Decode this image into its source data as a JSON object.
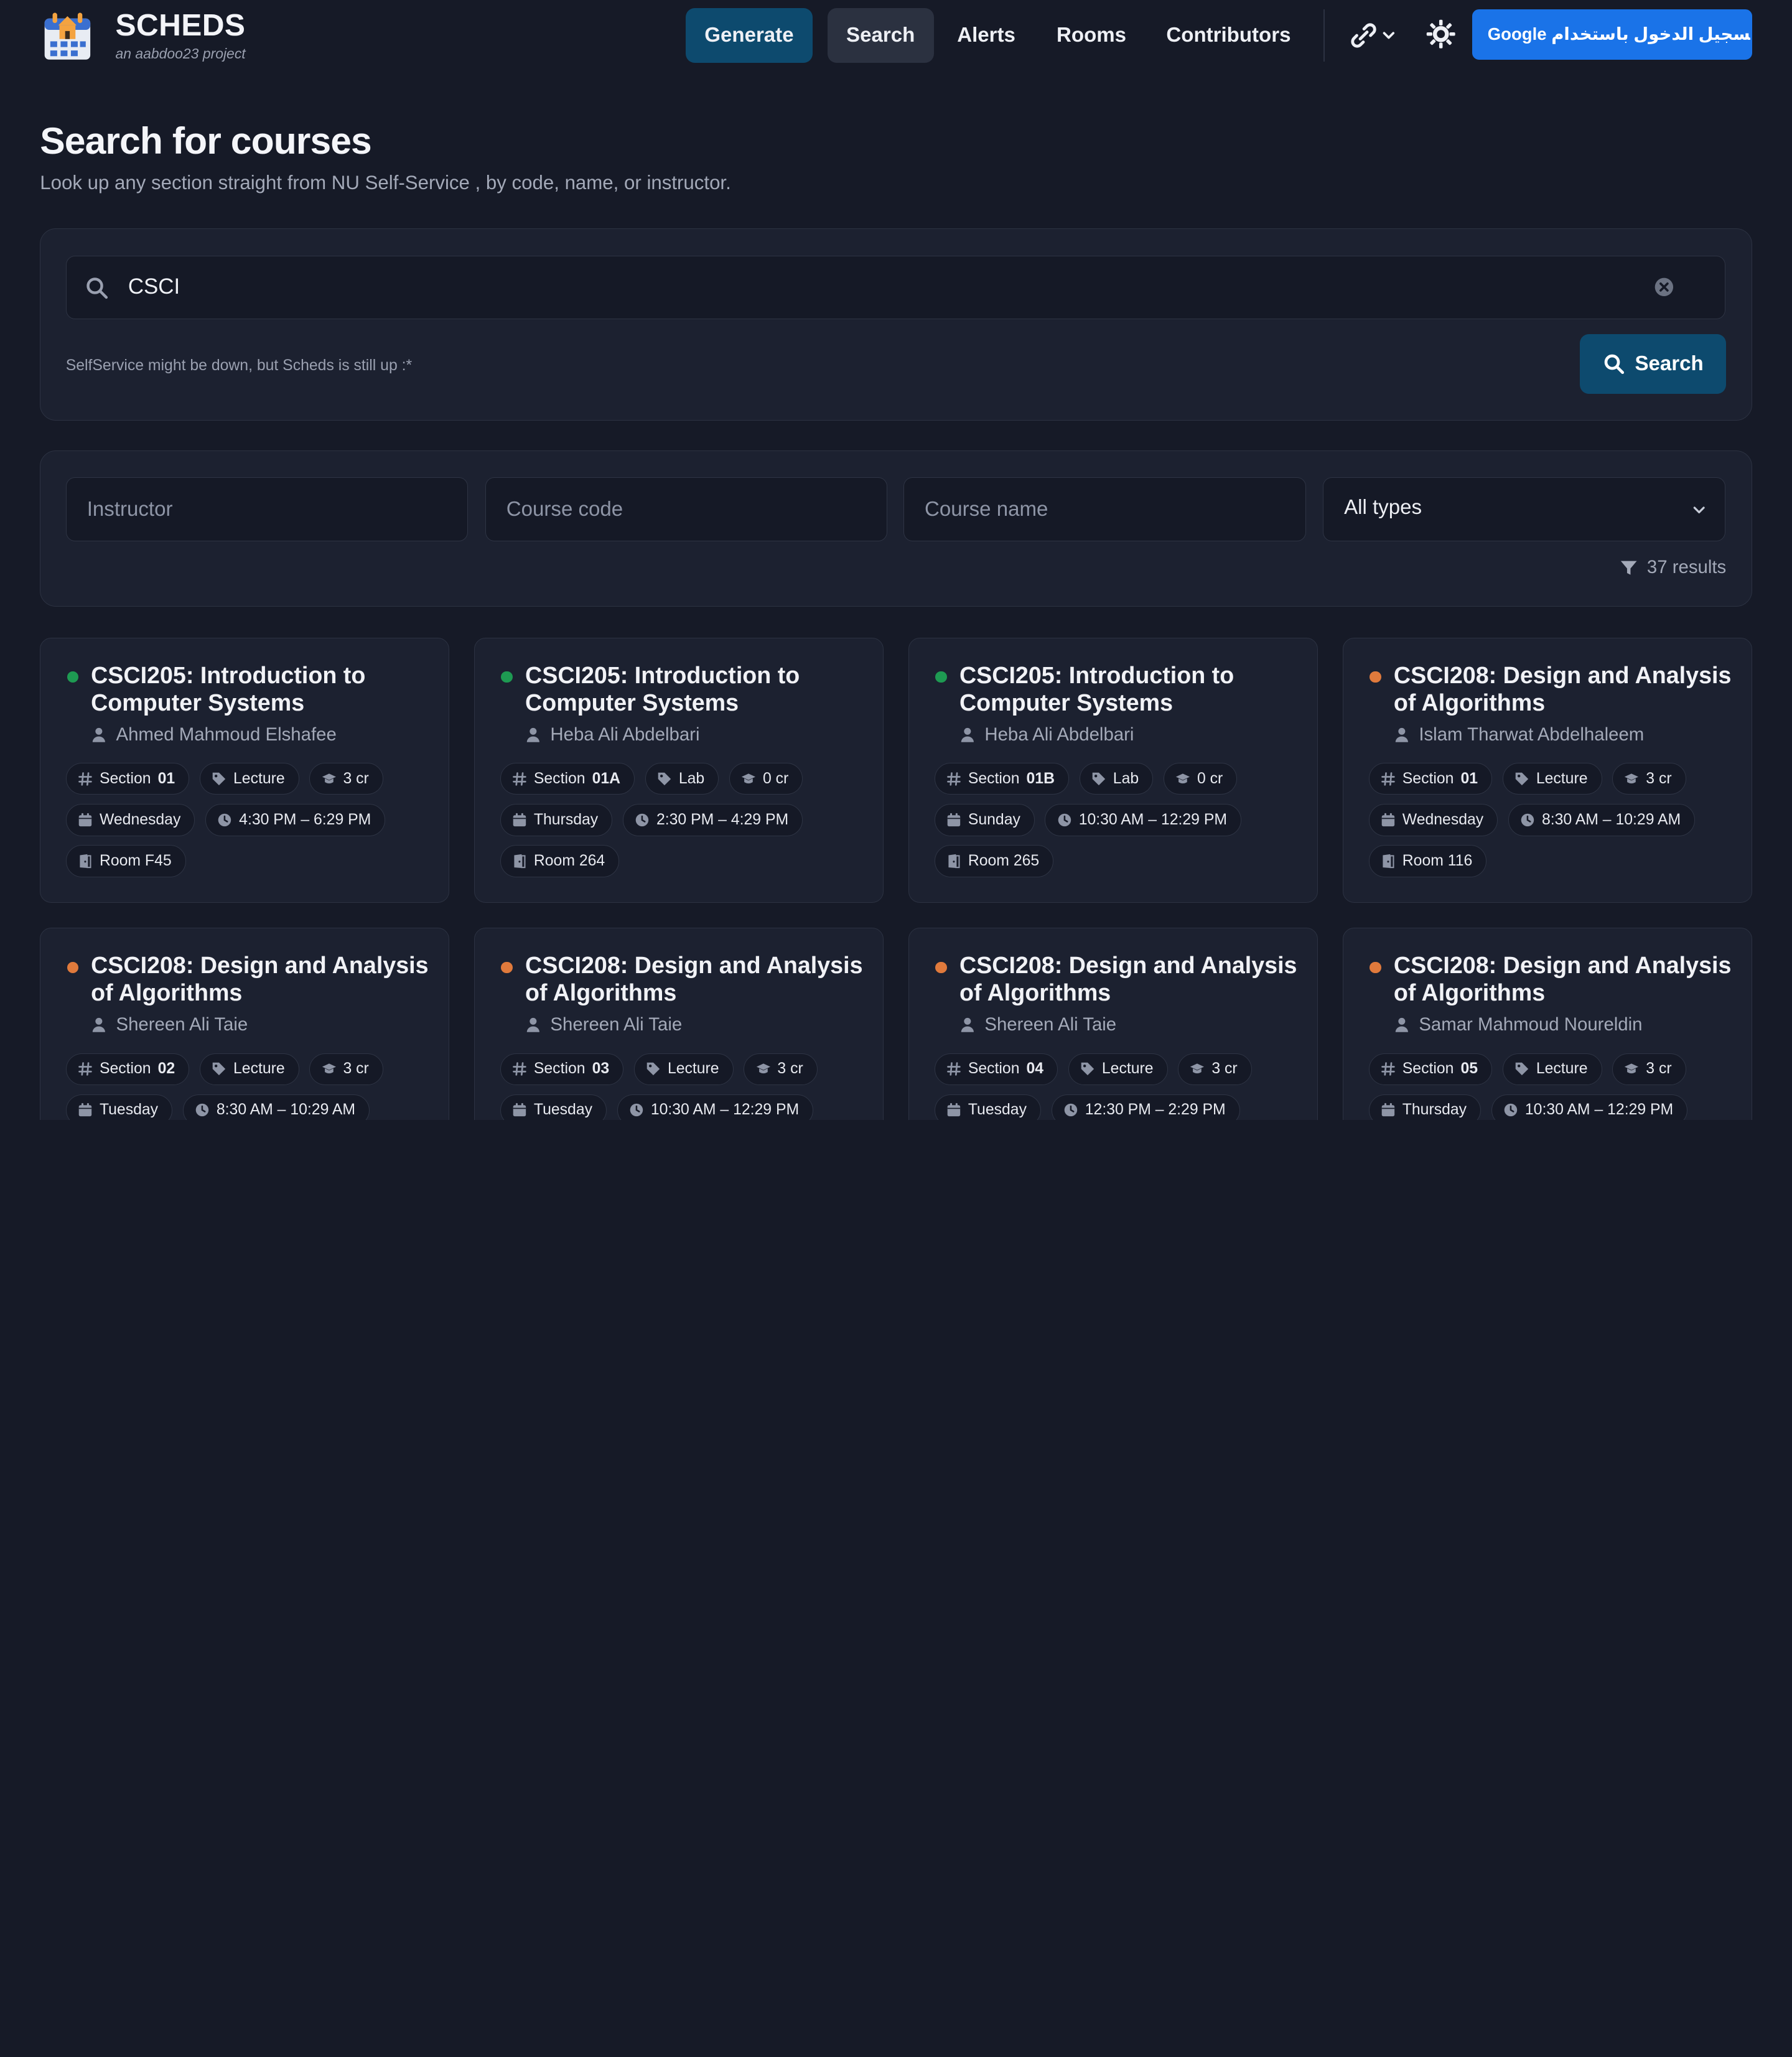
{
  "brand": {
    "title": "SCHEDS",
    "subtitle": "an aabdoo23 project"
  },
  "nav": {
    "generate": "Generate",
    "search": "Search",
    "alerts": "Alerts",
    "rooms": "Rooms",
    "contributors": "Contributors",
    "google_signin": "تسجيل الدخول باستخدام Google"
  },
  "page": {
    "title": "Search for courses",
    "subtitle": "Look up any section straight from NU Self-Service , by code, name, or instructor."
  },
  "search": {
    "query": "CSCI",
    "hint": "SelfService might be down, but Scheds is still up :*",
    "button": "Search"
  },
  "filters": {
    "instructor_placeholder": "Instructor",
    "code_placeholder": "Course code",
    "name_placeholder": "Course name",
    "type_selected": "All types",
    "results": "37 results"
  },
  "colors": {
    "green": "#1e9a52",
    "orange": "#e07a3c",
    "accent": "#0d4a6e"
  },
  "section_label": "Section",
  "cards": [
    {
      "status": "green",
      "title": "CSCI205: Introduction to Computer Systems",
      "instructor": "Ahmed Mahmoud Elshafee",
      "section": "01",
      "type": "Lecture",
      "credits": "3 cr",
      "day": "Wednesday",
      "time": "4:30 PM – 6:29 PM",
      "room": "Room F45"
    },
    {
      "status": "green",
      "title": "CSCI205: Introduction to Computer Systems",
      "instructor": "Heba Ali Abdelbari",
      "section": "01A",
      "type": "Lab",
      "credits": "0 cr",
      "day": "Thursday",
      "time": "2:30 PM – 4:29 PM",
      "room": "Room 264"
    },
    {
      "status": "green",
      "title": "CSCI205: Introduction to Computer Systems",
      "instructor": "Heba Ali Abdelbari",
      "section": "01B",
      "type": "Lab",
      "credits": "0 cr",
      "day": "Sunday",
      "time": "10:30 AM – 12:29 PM",
      "room": "Room 265"
    },
    {
      "status": "orange",
      "title": "CSCI208: Design and Analysis of Algorithms",
      "instructor": "Islam Tharwat Abdelhaleem",
      "section": "01",
      "type": "Lecture",
      "credits": "3 cr",
      "day": "Wednesday",
      "time": "8:30 AM – 10:29 AM",
      "room": "Room 116"
    },
    {
      "status": "orange",
      "title": "CSCI208: Design and Analysis of Algorithms",
      "instructor": "Shereen Ali Taie",
      "section": "02",
      "type": "Lecture",
      "credits": "3 cr",
      "day": "Tuesday",
      "time": "8:30 AM – 10:29 AM",
      "room": ""
    },
    {
      "status": "orange",
      "title": "CSCI208: Design and Analysis of Algorithms",
      "instructor": "Shereen Ali Taie",
      "section": "03",
      "type": "Lecture",
      "credits": "3 cr",
      "day": "Tuesday",
      "time": "10:30 AM – 12:29 PM",
      "room": ""
    },
    {
      "status": "orange",
      "title": "CSCI208: Design and Analysis of Algorithms",
      "instructor": "Shereen Ali Taie",
      "section": "04",
      "type": "Lecture",
      "credits": "3 cr",
      "day": "Tuesday",
      "time": "12:30 PM – 2:29 PM",
      "room": ""
    },
    {
      "status": "orange",
      "title": "CSCI208: Design and Analysis of Algorithms",
      "instructor": "Samar Mahmoud Noureldin",
      "section": "05",
      "type": "Lecture",
      "credits": "3 cr",
      "day": "Thursday",
      "time": "10:30 AM – 12:29 PM",
      "room": ""
    }
  ]
}
